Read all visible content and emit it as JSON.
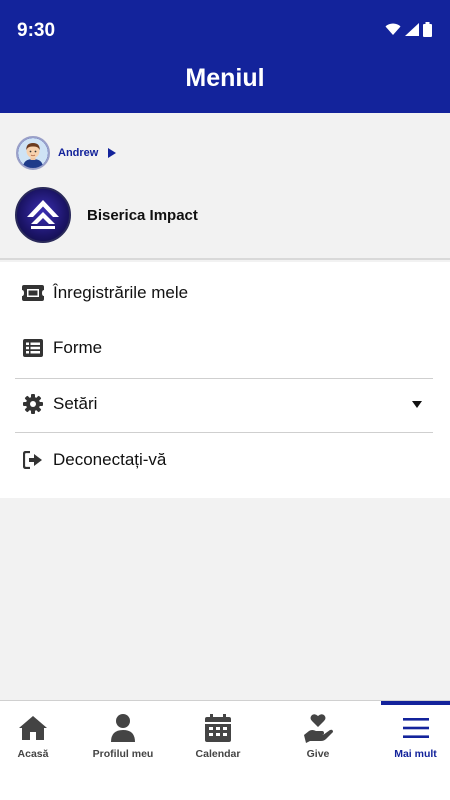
{
  "status_bar": {
    "time": "9:30"
  },
  "header": {
    "title": "Meniul"
  },
  "user": {
    "name": "Andrew"
  },
  "church": {
    "name": "Biserica Impact"
  },
  "menu": {
    "items": [
      {
        "label": "Înregistrările mele",
        "icon": "ticket-icon"
      },
      {
        "label": "Forme",
        "icon": "list-icon"
      },
      {
        "label": "Setări",
        "icon": "gear-icon"
      },
      {
        "label": "Deconectați-vă",
        "icon": "logout-icon"
      }
    ]
  },
  "tabbar": {
    "tabs": [
      {
        "label": "Acasă",
        "icon": "home-icon"
      },
      {
        "label": "Profilul meu",
        "icon": "person-icon"
      },
      {
        "label": "Calendar",
        "icon": "calendar-icon"
      },
      {
        "label": "Give",
        "icon": "heart-hand-icon"
      },
      {
        "label": "Mai mult",
        "icon": "menu-icon",
        "active": true
      }
    ]
  },
  "colors": {
    "brand": "#13239b",
    "background": "#f2f2f2",
    "icon": "#333333"
  }
}
